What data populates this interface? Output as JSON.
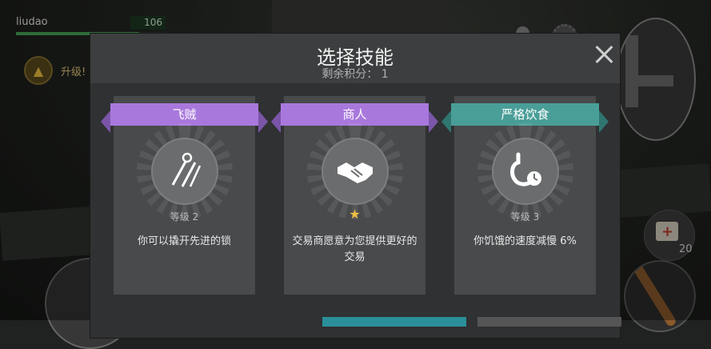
{
  "hud": {
    "player_name": "liudao",
    "player_level": "106",
    "xp_progress": 0.82,
    "upgrade_label": "升级!",
    "medkit_count": "20"
  },
  "dialog": {
    "title": "选择技能",
    "points_label": "剩余积分：",
    "points_value": "1"
  },
  "skills": [
    {
      "name": "飞贼",
      "level": "等级 2",
      "description": "你可以撬开先进的锁",
      "ribbon_color": "#a978dc",
      "icon": "lockpick-icon"
    },
    {
      "name": "商人",
      "level": "",
      "description": "交易商愿意为您提供更好的交易",
      "ribbon_color": "#a978dc",
      "icon": "handshake-icon",
      "rating_icon": "star-icon"
    },
    {
      "name": "严格饮食",
      "level": "等级 3",
      "description": "你饥饿的速度减慢 6%",
      "ribbon_color": "#4a9e98",
      "icon": "stomach-clock-icon"
    }
  ],
  "colors": {
    "accent_purple": "#a978dc",
    "accent_teal": "#4a9e98",
    "star": "#f0c040"
  }
}
